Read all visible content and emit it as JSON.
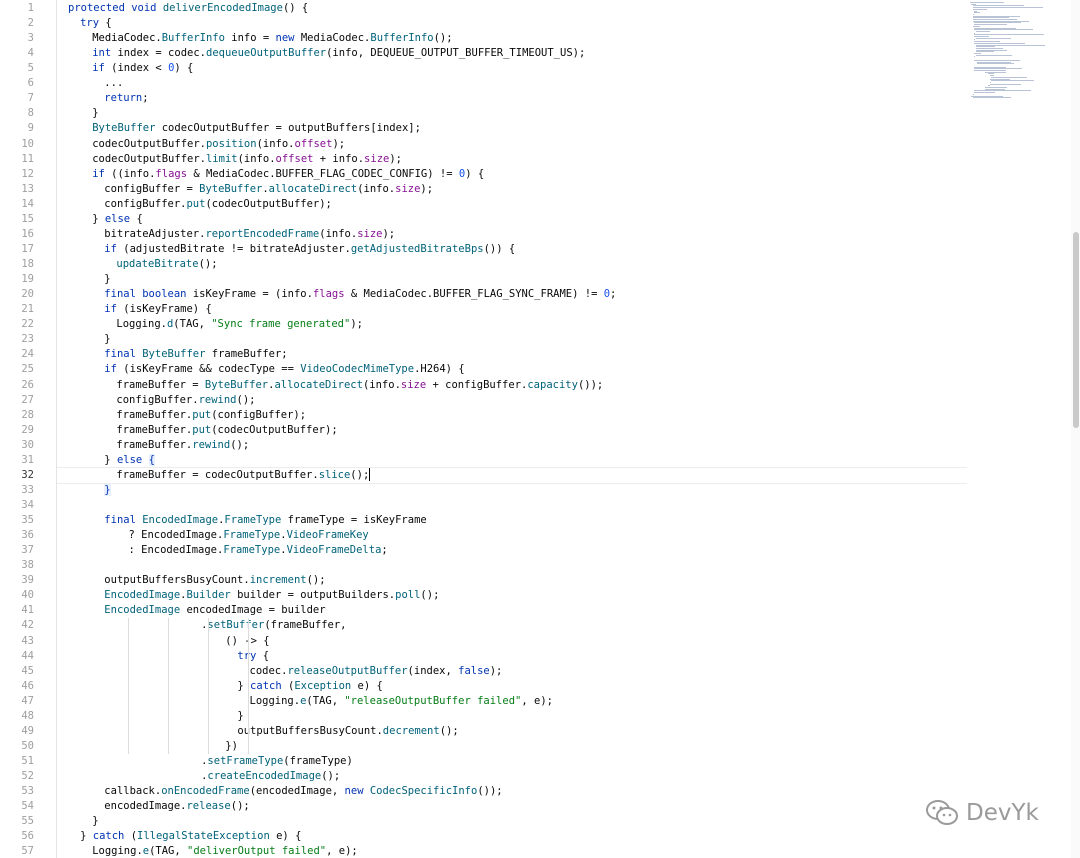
{
  "editor": {
    "current_line": 32,
    "watermark": "DevYk",
    "colors": {
      "keyword": "#0033b3",
      "method": "#00627a",
      "string": "#067d17",
      "number": "#1750eb",
      "field": "#871094",
      "line_number": "#9e9e9e"
    },
    "lines": [
      {
        "n": "1",
        "indent": 0,
        "t": [
          [
            "protected ",
            "kw"
          ],
          [
            "void ",
            "kw"
          ],
          [
            "deliverEncodedImage",
            "fn"
          ],
          [
            "() {",
            ""
          ]
        ]
      },
      {
        "n": "2",
        "indent": 1,
        "t": [
          [
            "try ",
            "kw"
          ],
          [
            "{",
            ""
          ]
        ]
      },
      {
        "n": "3",
        "indent": 2,
        "t": [
          [
            "MediaCodec",
            "cls"
          ],
          [
            ".",
            ""
          ],
          [
            "BufferInfo",
            "fn"
          ],
          [
            " info = ",
            ""
          ],
          [
            "new ",
            "kw"
          ],
          [
            "MediaCodec.",
            ""
          ],
          [
            "BufferInfo",
            "fn"
          ],
          [
            "();",
            ""
          ]
        ]
      },
      {
        "n": "4",
        "indent": 2,
        "t": [
          [
            "int ",
            "kw"
          ],
          [
            "index = codec.",
            ""
          ],
          [
            "dequeueOutputBuffer",
            "fn"
          ],
          [
            "(info, DEQUEUE_OUTPUT_BUFFER_TIMEOUT_US);",
            ""
          ]
        ]
      },
      {
        "n": "5",
        "indent": 2,
        "t": [
          [
            "if ",
            "kw"
          ],
          [
            "(index < ",
            ""
          ],
          [
            "0",
            "num"
          ],
          [
            ") {",
            ""
          ]
        ]
      },
      {
        "n": "6",
        "indent": 3,
        "t": [
          [
            "...",
            ""
          ]
        ]
      },
      {
        "n": "7",
        "indent": 3,
        "t": [
          [
            "return",
            "kw"
          ],
          [
            ";",
            ""
          ]
        ]
      },
      {
        "n": "8",
        "indent": 2,
        "t": [
          [
            "}",
            ""
          ]
        ]
      },
      {
        "n": "9",
        "indent": 2,
        "t": [
          [
            "ByteBuffer",
            "fn"
          ],
          [
            " codecOutputBuffer = outputBuffers[index];",
            ""
          ]
        ]
      },
      {
        "n": "10",
        "indent": 2,
        "t": [
          [
            "codecOutputBuffer.",
            ""
          ],
          [
            "position",
            "fn"
          ],
          [
            "(info.",
            ""
          ],
          [
            "offset",
            "fld"
          ],
          [
            ");",
            ""
          ]
        ]
      },
      {
        "n": "11",
        "indent": 2,
        "t": [
          [
            "codecOutputBuffer.",
            ""
          ],
          [
            "limit",
            "fn"
          ],
          [
            "(info.",
            ""
          ],
          [
            "offset",
            "fld"
          ],
          [
            " + info.",
            ""
          ],
          [
            "size",
            "fld"
          ],
          [
            ");",
            ""
          ]
        ]
      },
      {
        "n": "12",
        "indent": 2,
        "t": [
          [
            "if ",
            "kw"
          ],
          [
            "((info.",
            ""
          ],
          [
            "flags",
            "fld"
          ],
          [
            " & MediaCodec.BUFFER_FLAG_CODEC_CONFIG) != ",
            ""
          ],
          [
            "0",
            "num"
          ],
          [
            ") {",
            ""
          ]
        ]
      },
      {
        "n": "13",
        "indent": 3,
        "t": [
          [
            "configBuffer = ",
            ""
          ],
          [
            "ByteBuffer",
            "fn"
          ],
          [
            ".",
            ""
          ],
          [
            "allocateDirect",
            "fn"
          ],
          [
            "(info.",
            ""
          ],
          [
            "size",
            "fld"
          ],
          [
            ");",
            ""
          ]
        ]
      },
      {
        "n": "14",
        "indent": 3,
        "t": [
          [
            "configBuffer.",
            ""
          ],
          [
            "put",
            "fn"
          ],
          [
            "(codecOutputBuffer);",
            ""
          ]
        ]
      },
      {
        "n": "15",
        "indent": 2,
        "t": [
          [
            "} ",
            ""
          ],
          [
            "else ",
            "kw"
          ],
          [
            "{",
            ""
          ]
        ]
      },
      {
        "n": "16",
        "indent": 3,
        "t": [
          [
            "bitrateAdjuster.",
            ""
          ],
          [
            "reportEncodedFrame",
            "fn"
          ],
          [
            "(info.",
            ""
          ],
          [
            "size",
            "fld"
          ],
          [
            ");",
            ""
          ]
        ]
      },
      {
        "n": "17",
        "indent": 3,
        "t": [
          [
            "if ",
            "kw"
          ],
          [
            "(adjustedBitrate != bitrateAdjuster.",
            ""
          ],
          [
            "getAdjustedBitrateBps",
            "fn"
          ],
          [
            "()) {",
            ""
          ]
        ]
      },
      {
        "n": "18",
        "indent": 4,
        "t": [
          [
            "updateBitrate",
            "fn"
          ],
          [
            "();",
            ""
          ]
        ]
      },
      {
        "n": "19",
        "indent": 3,
        "t": [
          [
            "}",
            ""
          ]
        ]
      },
      {
        "n": "20",
        "indent": 3,
        "t": [
          [
            "final ",
            "kw"
          ],
          [
            "boolean ",
            "kw"
          ],
          [
            "isKeyFrame = (info.",
            ""
          ],
          [
            "flags",
            "fld"
          ],
          [
            " & MediaCodec.BUFFER_FLAG_SYNC_FRAME) != ",
            ""
          ],
          [
            "0",
            "num"
          ],
          [
            ";",
            ""
          ]
        ]
      },
      {
        "n": "21",
        "indent": 3,
        "t": [
          [
            "if ",
            "kw"
          ],
          [
            "(isKeyFrame) {",
            ""
          ]
        ]
      },
      {
        "n": "22",
        "indent": 4,
        "t": [
          [
            "Logging.",
            ""
          ],
          [
            "d",
            "fn"
          ],
          [
            "(TAG, ",
            ""
          ],
          [
            "\"Sync frame generated\"",
            "str"
          ],
          [
            ");",
            ""
          ]
        ]
      },
      {
        "n": "23",
        "indent": 3,
        "t": [
          [
            "}",
            ""
          ]
        ]
      },
      {
        "n": "24",
        "indent": 3,
        "t": [
          [
            "final ",
            "kw"
          ],
          [
            "ByteBuffer",
            "fn"
          ],
          [
            " frameBuffer;",
            ""
          ]
        ]
      },
      {
        "n": "25",
        "indent": 3,
        "t": [
          [
            "if ",
            "kw"
          ],
          [
            "(isKeyFrame && codecType == ",
            ""
          ],
          [
            "VideoCodecMimeType",
            "fn"
          ],
          [
            ".H264) {",
            ""
          ]
        ]
      },
      {
        "n": "26",
        "indent": 4,
        "t": [
          [
            "frameBuffer = ",
            ""
          ],
          [
            "ByteBuffer",
            "fn"
          ],
          [
            ".",
            ""
          ],
          [
            "allocateDirect",
            "fn"
          ],
          [
            "(info.",
            ""
          ],
          [
            "size",
            "fld"
          ],
          [
            " + configBuffer.",
            ""
          ],
          [
            "capacity",
            "fn"
          ],
          [
            "());",
            ""
          ]
        ]
      },
      {
        "n": "27",
        "indent": 4,
        "t": [
          [
            "configBuffer.",
            ""
          ],
          [
            "rewind",
            "fn"
          ],
          [
            "();",
            ""
          ]
        ]
      },
      {
        "n": "28",
        "indent": 4,
        "t": [
          [
            "frameBuffer.",
            ""
          ],
          [
            "put",
            "fn"
          ],
          [
            "(configBuffer);",
            ""
          ]
        ]
      },
      {
        "n": "29",
        "indent": 4,
        "t": [
          [
            "frameBuffer.",
            ""
          ],
          [
            "put",
            "fn"
          ],
          [
            "(codecOutputBuffer);",
            ""
          ]
        ]
      },
      {
        "n": "30",
        "indent": 4,
        "t": [
          [
            "frameBuffer.",
            ""
          ],
          [
            "rewind",
            "fn"
          ],
          [
            "();",
            ""
          ]
        ]
      },
      {
        "n": "31",
        "indent": 3,
        "t": [
          [
            "} ",
            ""
          ],
          [
            "else ",
            "kw"
          ],
          [
            "{",
            "br"
          ]
        ]
      },
      {
        "n": "32",
        "indent": 4,
        "t": [
          [
            "frameBuffer = codecOutputBuffer.",
            ""
          ],
          [
            "slice",
            "fn"
          ],
          [
            "();",
            ""
          ]
        ]
      },
      {
        "n": "33",
        "indent": 3,
        "t": [
          [
            "}",
            "br"
          ]
        ]
      },
      {
        "n": "34",
        "indent": 0,
        "t": []
      },
      {
        "n": "35",
        "indent": 3,
        "t": [
          [
            "final ",
            "kw"
          ],
          [
            "EncodedImage",
            "fn"
          ],
          [
            ".",
            ""
          ],
          [
            "FrameType",
            "fn"
          ],
          [
            " frameType = isKeyFrame",
            ""
          ]
        ]
      },
      {
        "n": "36",
        "indent": 5,
        "t": [
          [
            "? EncodedImage.",
            ""
          ],
          [
            "FrameType",
            "fn"
          ],
          [
            ".",
            ""
          ],
          [
            "VideoFrameKey",
            "fn"
          ]
        ]
      },
      {
        "n": "37",
        "indent": 5,
        "t": [
          [
            ": EncodedImage.",
            ""
          ],
          [
            "FrameType",
            "fn"
          ],
          [
            ".",
            ""
          ],
          [
            "VideoFrameDelta",
            "fn"
          ],
          [
            ";",
            ""
          ]
        ]
      },
      {
        "n": "38",
        "indent": 0,
        "t": []
      },
      {
        "n": "39",
        "indent": 3,
        "t": [
          [
            "outputBuffersBusyCount.",
            ""
          ],
          [
            "increment",
            "fn"
          ],
          [
            "();",
            ""
          ]
        ]
      },
      {
        "n": "40",
        "indent": 3,
        "t": [
          [
            "EncodedImage",
            "fn"
          ],
          [
            ".",
            ""
          ],
          [
            "Builder",
            "fn"
          ],
          [
            " builder = outputBuilders.",
            ""
          ],
          [
            "poll",
            "fn"
          ],
          [
            "();",
            ""
          ]
        ]
      },
      {
        "n": "41",
        "indent": 3,
        "t": [
          [
            "EncodedImage",
            "fn"
          ],
          [
            " encodedImage = builder",
            ""
          ]
        ]
      },
      {
        "n": "42",
        "indent": 11,
        "t": [
          [
            ".",
            ""
          ],
          [
            "setBuffer",
            "fn"
          ],
          [
            "(frameBuffer,",
            ""
          ]
        ]
      },
      {
        "n": "43",
        "indent": 13,
        "t": [
          [
            "() -> {",
            ""
          ]
        ]
      },
      {
        "n": "44",
        "indent": 14,
        "t": [
          [
            "try ",
            "kw"
          ],
          [
            "{",
            ""
          ]
        ]
      },
      {
        "n": "45",
        "indent": 15,
        "t": [
          [
            "codec.",
            ""
          ],
          [
            "releaseOutputBuffer",
            "fn"
          ],
          [
            "(index, ",
            ""
          ],
          [
            "false",
            "kw"
          ],
          [
            ");",
            ""
          ]
        ]
      },
      {
        "n": "46",
        "indent": 14,
        "t": [
          [
            "} ",
            ""
          ],
          [
            "catch ",
            "kw"
          ],
          [
            "(",
            ""
          ],
          [
            "Exception",
            "fn"
          ],
          [
            " e) {",
            ""
          ]
        ]
      },
      {
        "n": "47",
        "indent": 15,
        "t": [
          [
            "Logging.",
            ""
          ],
          [
            "e",
            "fn"
          ],
          [
            "(TAG, ",
            ""
          ],
          [
            "\"releaseOutputBuffer failed\"",
            "str"
          ],
          [
            ", e);",
            ""
          ]
        ]
      },
      {
        "n": "48",
        "indent": 14,
        "t": [
          [
            "}",
            ""
          ]
        ]
      },
      {
        "n": "49",
        "indent": 14,
        "t": [
          [
            "outputBuffersBusyCount.",
            ""
          ],
          [
            "decrement",
            "fn"
          ],
          [
            "();",
            ""
          ]
        ]
      },
      {
        "n": "50",
        "indent": 13,
        "t": [
          [
            "})",
            ""
          ]
        ]
      },
      {
        "n": "51",
        "indent": 11,
        "t": [
          [
            ".",
            ""
          ],
          [
            "setFrameType",
            "fn"
          ],
          [
            "(frameType)",
            ""
          ]
        ]
      },
      {
        "n": "52",
        "indent": 11,
        "t": [
          [
            ".",
            ""
          ],
          [
            "createEncodedImage",
            "fn"
          ],
          [
            "();",
            ""
          ]
        ]
      },
      {
        "n": "53",
        "indent": 3,
        "t": [
          [
            "callback.",
            ""
          ],
          [
            "onEncodedFrame",
            "fn"
          ],
          [
            "(encodedImage, ",
            ""
          ],
          [
            "new ",
            "kw"
          ],
          [
            "CodecSpecificInfo",
            "fn"
          ],
          [
            "());",
            ""
          ]
        ]
      },
      {
        "n": "54",
        "indent": 3,
        "t": [
          [
            "encodedImage.",
            ""
          ],
          [
            "release",
            "fn"
          ],
          [
            "();",
            ""
          ]
        ]
      },
      {
        "n": "55",
        "indent": 2,
        "t": [
          [
            "}",
            ""
          ]
        ]
      },
      {
        "n": "56",
        "indent": 1,
        "t": [
          [
            "} ",
            ""
          ],
          [
            "catch ",
            "kw"
          ],
          [
            "(",
            ""
          ],
          [
            "IllegalStateException",
            "fn"
          ],
          [
            " e) {",
            ""
          ]
        ]
      },
      {
        "n": "57",
        "indent": 2,
        "t": [
          [
            "Logging.",
            ""
          ],
          [
            "e",
            "fn"
          ],
          [
            "(TAG, ",
            ""
          ],
          [
            "\"deliverOutput failed\"",
            "str"
          ],
          [
            ", e);",
            ""
          ]
        ]
      }
    ]
  }
}
